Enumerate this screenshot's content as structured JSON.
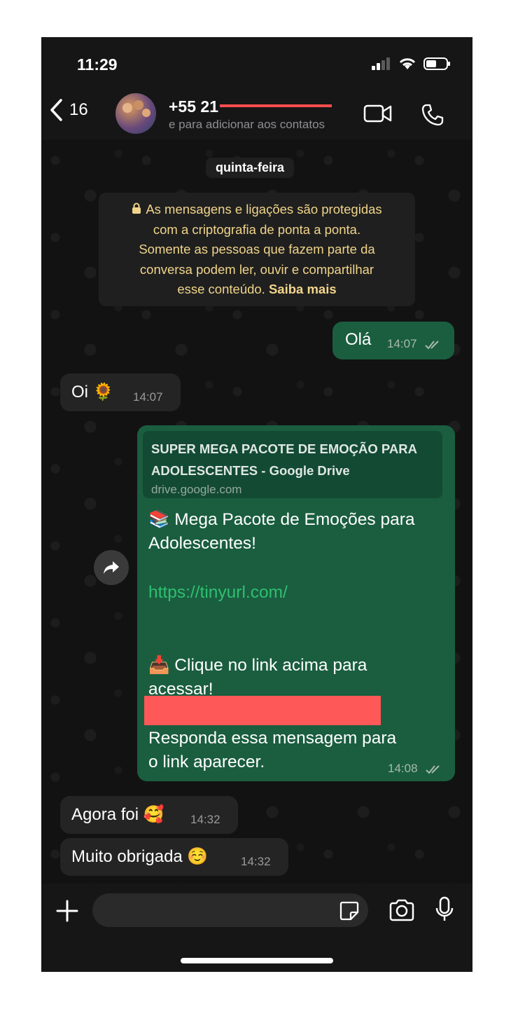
{
  "status_bar": {
    "time": "11:29"
  },
  "header": {
    "back_count": "16",
    "contact_name": "+55 21",
    "contact_subtitle": "e para adicionar aos contatos"
  },
  "chat": {
    "date_label": "quinta-feira",
    "encryption_notice": {
      "line1": "As mensagens e ligações são protegidas",
      "line2": "com a criptografia de ponta a ponta.",
      "line3": "Somente as pessoas que fazem parte da",
      "line4": "conversa podem ler, ouvir e compartilhar",
      "line5_text": "esse conteúdo.",
      "learn_more": "Saiba mais"
    },
    "messages": [
      {
        "direction": "out",
        "text": "Olá",
        "time": "14:07"
      },
      {
        "direction": "in",
        "text": "Oi 🌻",
        "time": "14:07"
      },
      {
        "direction": "out",
        "link_preview": {
          "title_line1": "SUPER MEGA PACOTE DE EMOÇÃO PARA",
          "title_line2": "ADOLESCENTES - Google Drive",
          "domain": "drive.google.com"
        },
        "line1": "📚 Mega Pacote de Emoções para",
        "line2": "Adolescentes!",
        "link_visible": "https://tinyurl.com/",
        "line3": "📥 Clique no link acima para",
        "line4": "acessar!",
        "line5": "Responda essa mensagem para",
        "line6": "o link aparecer.",
        "time": "14:08"
      },
      {
        "direction": "in",
        "text": "Agora foi 🥰",
        "time": "14:32"
      },
      {
        "direction": "in",
        "text": "Muito obrigada ☺️",
        "time": "14:32"
      }
    ]
  },
  "colors": {
    "outgoing_bubble": "#1a5e3f",
    "incoming_bubble": "#242424",
    "link": "#2fbf71",
    "encryption_text": "#f0d48a",
    "redaction": "#ff5858"
  },
  "icons": [
    "back-chevron-icon",
    "video-call-icon",
    "phone-call-icon",
    "lock-icon",
    "forward-icon",
    "double-check-icon",
    "plus-icon",
    "sticker-icon",
    "camera-icon",
    "microphone-icon"
  ]
}
